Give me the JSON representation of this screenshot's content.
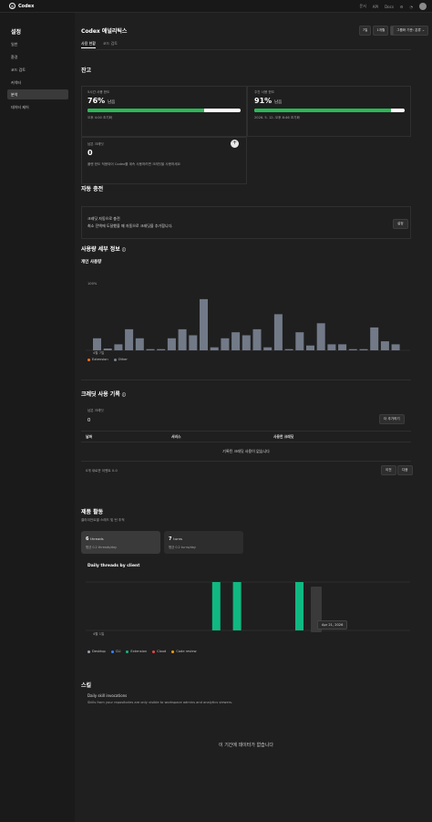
{
  "topbar": {
    "app_name": "Codex",
    "items": [
      "문서",
      "API",
      "Docs"
    ]
  },
  "sidebar": {
    "title": "설정",
    "items": [
      {
        "label": "일반",
        "active": false
      },
      {
        "label": "환경",
        "active": false
      },
      {
        "label": "코드 검토",
        "active": false
      },
      {
        "label": "커넥터",
        "active": false
      },
      {
        "label": "분석",
        "active": true
      },
      {
        "label": "데이터 제어",
        "active": false
      }
    ]
  },
  "header": {
    "title": "Codex 애널리틱스",
    "tabs": [
      {
        "label": "사용 현황",
        "active": true
      },
      {
        "label": "코드 검토",
        "active": false
      }
    ],
    "range_buttons": [
      {
        "label": "7일",
        "active": false
      },
      {
        "label": "1개월",
        "active": false
      },
      {
        "label": "사용자 지정",
        "active": true
      }
    ],
    "group_select": "그룹화 기준: 분류"
  },
  "balance": {
    "title": "잔고",
    "limit_5h": {
      "label": "5시간 사용 한도",
      "percent_text": "76%",
      "unit": "남음",
      "sub": "오후 4:00 초기화",
      "fraction": 0.76
    },
    "limit_week": {
      "label": "주간 사용 한도",
      "percent_text": "91%",
      "unit": "남음",
      "sub": "2026. 5. 12. 오후 8:46 초기화",
      "fraction": 0.91
    },
    "credits": {
      "label": "남은 크레딧",
      "value": "0",
      "sub": "플랜 한도 적용되어 Codex를 계속 사용하려면 크레딧을 사용하세요"
    }
  },
  "auto_recharge": {
    "title": "자동 충전",
    "line1": "크레딧 자동으로 충전",
    "line2": "최소 잔액에 도달했을 때 자동으로 크레딧을 추가합니다.",
    "button": "설정"
  },
  "usage_detail": {
    "title": "사용량 세부 정보",
    "subtitle": "개인 사용량",
    "y_top": "100%",
    "x_start": "4월 7일",
    "legend": [
      "Extension",
      "Other"
    ]
  },
  "credit_history": {
    "title": "크레딧 사용 기록",
    "remaining_label": "남은 크레딧",
    "remaining_value": "0",
    "add_button": "더 추가하기",
    "columns": [
      "날짜",
      "서비스",
      "사용한 크레딧"
    ],
    "empty": "기록된 크레딧 사용이 없습니다",
    "footer": "0개 새로운 이벤트 0-0",
    "prev": "이전",
    "next": "다음"
  },
  "product_activity": {
    "title": "제품 활동",
    "subtitle": "클라이언트별 스레드 및 턴 추적",
    "cards": [
      {
        "value": "6",
        "unit": "threads",
        "sub": "평균 0.2 threads/day",
        "active": true
      },
      {
        "value": "7",
        "unit": "turns",
        "sub": "평균 0.2 turns/day",
        "active": false
      }
    ],
    "chart_title": "Daily threads by client",
    "x_start": "4월 1일",
    "tooltip": "Apr 21, 2026",
    "legend": [
      {
        "name": "Desktop",
        "color": "#9aa0aa"
      },
      {
        "name": "CLI",
        "color": "#3b82f6"
      },
      {
        "name": "Extension",
        "color": "#10b981"
      },
      {
        "name": "Cloud",
        "color": "#ef4444"
      },
      {
        "name": "Code review",
        "color": "#f59e0b"
      }
    ]
  },
  "skills": {
    "title": "스킬",
    "subtitle": "Daily skill invocations",
    "desc": "Skills from your repositories are only visible to workspace admins and analytics viewers.",
    "empty": "이 기간에 데이터가 없습니다"
  },
  "chart_data": [
    {
      "type": "bar",
      "title": "",
      "series": [
        {
          "name": "Other",
          "values": [
            0.2,
            0.03,
            0.1,
            0.35,
            0.2,
            0.02,
            0.02,
            0.2,
            0.35,
            0.25,
            0.85,
            0.05,
            0.2,
            0.3,
            0.25,
            0.35,
            0.05,
            0.6,
            0.02,
            0.3,
            0.08,
            0.45,
            0.1,
            0.1,
            0.02,
            0.02,
            0.38,
            0.15,
            0.1
          ]
        }
      ],
      "ylim": [
        0,
        1
      ]
    },
    {
      "type": "bar",
      "title": "Daily threads by client",
      "series": [
        {
          "name": "Extension",
          "values": [
            0,
            0,
            0,
            0,
            0,
            0,
            0,
            0,
            0,
            0,
            0,
            0,
            1,
            0,
            1,
            0,
            0,
            0,
            0,
            0,
            1,
            0,
            0,
            0,
            0,
            0,
            0,
            0,
            0,
            0
          ]
        }
      ],
      "ylim": [
        0,
        1
      ]
    }
  ]
}
